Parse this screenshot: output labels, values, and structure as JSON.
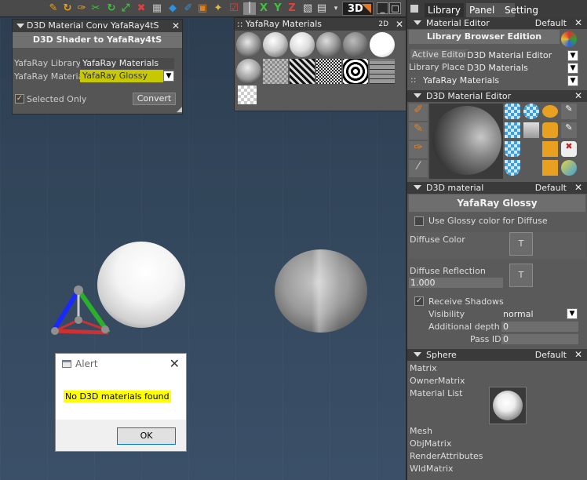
{
  "toolbar": {
    "view_mode": "3D",
    "icons": [
      "pick-icon",
      "rotate-icon",
      "select-icon",
      "tool-icon",
      "move-icon",
      "scale-icon",
      "delete-icon",
      "material-icon",
      "paint-icon",
      "brush-icon",
      "render-icon",
      "camera-icon",
      "x-axis-icon",
      "y-axis-icon",
      "z-axis-icon",
      "grid-icon",
      "view-icon"
    ]
  },
  "conv_panel": {
    "title": "D3D Material Conv YafaRay4tS",
    "header": "D3D Shader to YafaRay4tS",
    "library_label": "YafaRay Library",
    "library_value": "YafaRay Materials",
    "material_label": "YafaRay Material",
    "material_value": "YafaRay Glossy",
    "selected_only_label": "Selected Only",
    "convert_label": "Convert"
  },
  "yafa_panel": {
    "title": ":: YafaRay Materials",
    "badge": "2D"
  },
  "side": {
    "tabs": [
      "Library",
      "Panel",
      "Setting"
    ],
    "material_editor": {
      "title": "Material Editor",
      "default_label": "Default",
      "header": "Library Browser Edition",
      "rows": [
        {
          "label": "Active Editor",
          "value": "D3D Material Editor"
        },
        {
          "label": "Library Places",
          "value": "D3D Materials"
        },
        {
          "label": "::",
          "value": "YafaRay Materials"
        }
      ]
    },
    "d3d_editor": {
      "title": "D3D Material Editor"
    },
    "d3d_material": {
      "title": "D3D material",
      "default_label": "Default",
      "header": "YafaRay Glossy",
      "use_glossy_label": "Use Glossy color for Diffuse",
      "diffuse_color_label": "Diffuse Color",
      "diffuse_reflection_label": "Diffuse Reflection",
      "diffuse_reflection_value": "1.000",
      "t_button": "T",
      "receive_shadows_label": "Receive Shadows",
      "visibility_label": "Visibility",
      "visibility_value": "normal",
      "additional_depth_label": "Additional depth",
      "additional_depth_value": "0",
      "pass_id_label": "Pass ID",
      "pass_id_value": "0"
    },
    "sphere": {
      "title": "Sphere",
      "default_label": "Default",
      "items": [
        "Matrix",
        "OwnerMatrix",
        "Material List",
        "Mesh",
        "ObjMatrix",
        "RenderAttributes",
        "WldMatrix"
      ]
    }
  },
  "alert": {
    "title": "Alert",
    "message": "No D3D materials found",
    "ok_label": "OK"
  },
  "colors": {
    "highlight_yellow": "#ffff00",
    "combo_highlight": "#c8c800",
    "accent_orange": "#e07a2a"
  }
}
